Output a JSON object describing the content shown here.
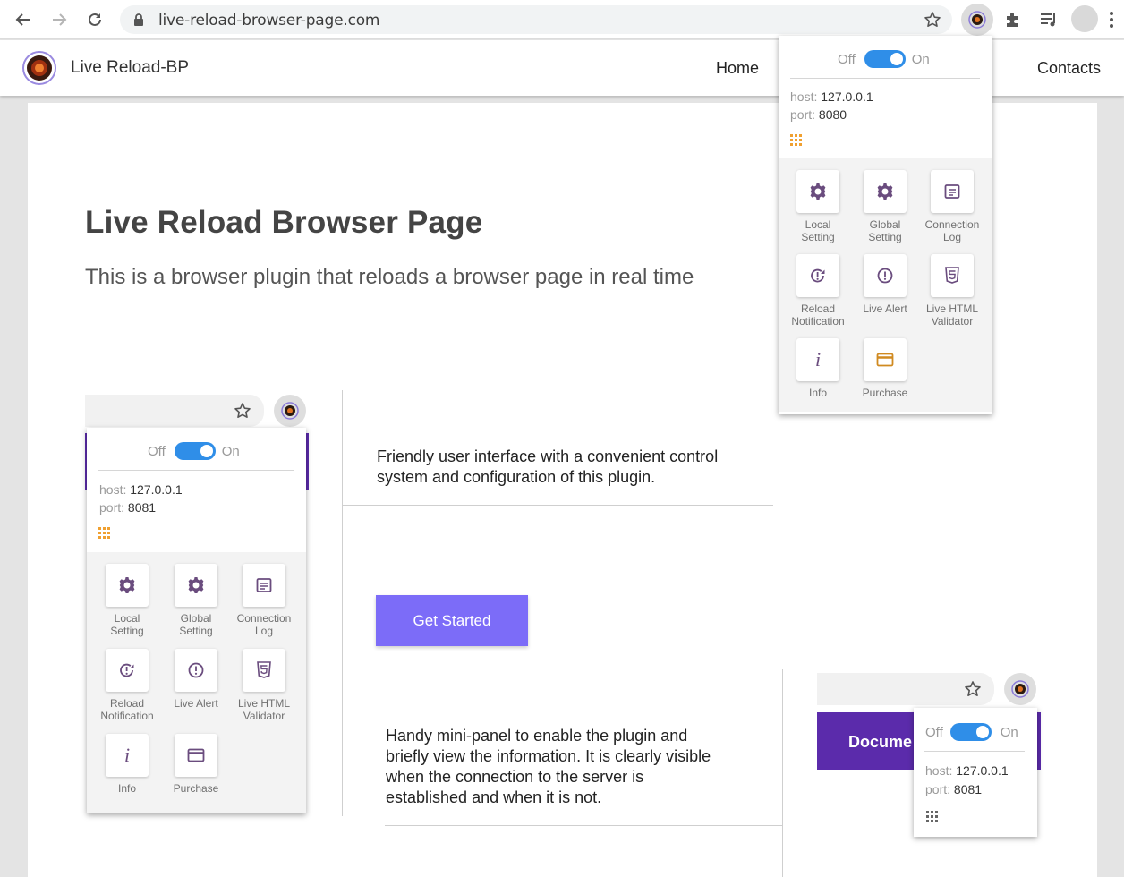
{
  "browser": {
    "url": "live-reload-browser-page.com"
  },
  "site": {
    "brand": "Live Reload-BP",
    "nav": [
      "Home",
      "Contacts"
    ]
  },
  "hero": {
    "title": "Live Reload Browser Page",
    "subtitle": "This is a browser plugin that reloads a browser page in real time"
  },
  "features": {
    "f1": [
      "Friendly user interface with a convenient control",
      "system and configuration of this plugin."
    ],
    "f2": [
      "Handy mini-panel to enable the plugin and",
      "briefly view the information. It is clearly visible",
      "when the connection to the server is",
      "established and when it is not."
    ],
    "cta": "Get Started"
  },
  "popup_main": {
    "off": "Off",
    "on": "On",
    "host_key": "host:",
    "host": "127.0.0.1",
    "port_key": "port:",
    "port": "8080",
    "tiles": [
      [
        "Local",
        "Setting"
      ],
      [
        "Global",
        "Setting"
      ],
      [
        "Connection",
        "Log"
      ],
      [
        "Reload",
        "Notification"
      ],
      [
        "Live Alert",
        ""
      ],
      [
        "Live HTML",
        "Validator"
      ],
      [
        "Info",
        ""
      ],
      [
        "Purchase",
        ""
      ]
    ]
  },
  "popup_shot": {
    "off": "Off",
    "on": "On",
    "host_key": "host:",
    "host": "127.0.0.1",
    "port_key": "port:",
    "port": "8081",
    "tiles": [
      [
        "Local",
        "Setting"
      ],
      [
        "Global",
        "Setting"
      ],
      [
        "Connection",
        "Log"
      ],
      [
        "Reload",
        "Notification"
      ],
      [
        "Live Alert",
        ""
      ],
      [
        "Live HTML",
        "Validator"
      ],
      [
        "Info",
        ""
      ],
      [
        "Purchase",
        ""
      ]
    ]
  },
  "popup_mini": {
    "off": "Off",
    "on": "On",
    "host_key": "host:",
    "host": "127.0.0.1",
    "port_key": "port:",
    "port": "8081",
    "band_text": "Docume"
  },
  "icons": {
    "accent": "#6a4c7e",
    "grid_orange": "#f0a030",
    "purchase": "#d08a20"
  }
}
